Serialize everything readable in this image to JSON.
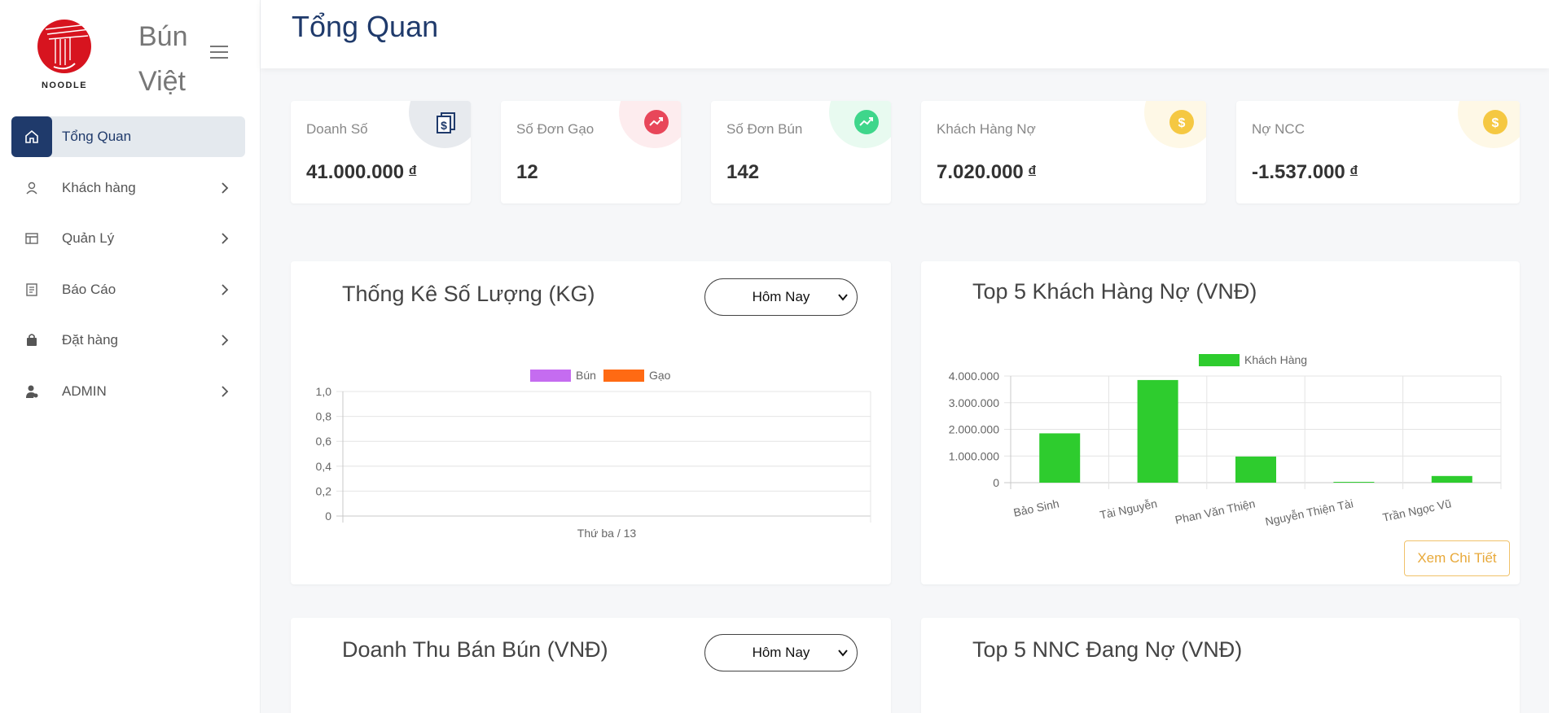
{
  "brand": {
    "name_line1": "Bún",
    "name_line2": "Việt",
    "logo_text": "NOODLE"
  },
  "sidebar": {
    "items": [
      {
        "label": "Tổng Quan",
        "icon": "home-icon",
        "active": true
      },
      {
        "label": "Khách hàng",
        "icon": "user-icon"
      },
      {
        "label": "Quản Lý",
        "icon": "table-icon"
      },
      {
        "label": "Báo Cáo",
        "icon": "report-icon"
      },
      {
        "label": "Đặt hàng",
        "icon": "bag-icon"
      },
      {
        "label": "ADMIN",
        "icon": "admin-icon"
      }
    ]
  },
  "header": {
    "title": "Tổng Quan"
  },
  "stats": [
    {
      "label": "Doanh Số",
      "value": "41.000.000",
      "currency": "đ",
      "icon": "document-dollar-icon",
      "color": "#1f3a6b"
    },
    {
      "label": "Số Đơn Gạo",
      "value": "12",
      "currency": "",
      "icon": "trend-icon",
      "color": "#e8475a"
    },
    {
      "label": "Số Đơn Bún",
      "value": "142",
      "currency": "",
      "icon": "trend-icon",
      "color": "#3fd68b"
    },
    {
      "label": "Khách Hàng Nợ",
      "value": "7.020.000",
      "currency": "đ",
      "icon": "dollar-icon",
      "color": "#f5c842"
    },
    {
      "label": "Nợ NCC",
      "value": "-1.537.000",
      "currency": "đ",
      "icon": "dollar-icon",
      "color": "#f5c842"
    }
  ],
  "panels": {
    "quantity": {
      "title": "Thống Kê Số Lượng (KG)",
      "select": "Hôm Nay"
    },
    "debtors": {
      "title": "Top 5 Khách Hàng Nợ (VNĐ)",
      "button": "Xem Chi Tiết"
    },
    "revenue": {
      "title": "Doanh Thu Bán Bún (VNĐ)",
      "select": "Hôm Nay"
    },
    "suppliers": {
      "title": "Top 5 NNC Đang Nợ (VNĐ)"
    }
  },
  "chart_data": [
    {
      "type": "bar",
      "categories": [
        "Thứ ba / 13"
      ],
      "series": [
        {
          "name": "Bún",
          "values": [
            0
          ],
          "color": "#c56cf0"
        },
        {
          "name": "Gạo",
          "values": [
            0
          ],
          "color": "#ff6a13"
        }
      ],
      "ylim": [
        0,
        1
      ],
      "yticks": [
        "0",
        "0,2",
        "0,4",
        "0,6",
        "0,8",
        "1,0"
      ],
      "legend": "top",
      "grid": true
    },
    {
      "type": "bar",
      "categories": [
        "Bảo Sinh",
        "Tài Nguyễn",
        "Phan Văn Thiện",
        "Nguyễn Thiện Tài",
        "Trần Ngọc Vũ"
      ],
      "series": [
        {
          "name": "Khách Hàng",
          "values": [
            1850000,
            3850000,
            980000,
            30000,
            250000
          ],
          "color": "#2ecc2e"
        }
      ],
      "ylim": [
        0,
        4000000
      ],
      "yticks": [
        "0",
        "1.000.000",
        "2.000.000",
        "3.000.000",
        "4.000.000"
      ],
      "legend": "top",
      "grid": true
    }
  ]
}
